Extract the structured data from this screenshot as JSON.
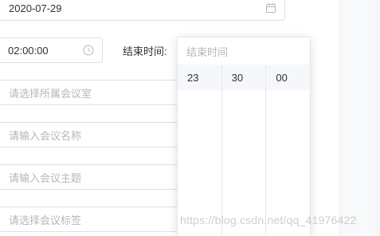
{
  "form": {
    "date_value": "2020-07-29",
    "start_time_value": "02:00:00",
    "end_time_label": "结束时间:",
    "room_placeholder": "请选择所属会议室",
    "name_placeholder": "请输入会议名称",
    "topic_placeholder": "请输入会议主题",
    "tags_placeholder": "请选择会议标签"
  },
  "time_picker": {
    "placeholder": "结束时间",
    "hour": "23",
    "minute": "30",
    "second": "00"
  },
  "watermark": "https://blog.csdn.net/qq_41976422",
  "icons": {
    "date": "calendar-icon",
    "time": "clock-icon"
  },
  "colors": {
    "border": "#dcdfe6",
    "placeholder": "#b5b7bc",
    "text": "#303133",
    "highlight": "#f5f7fa"
  }
}
